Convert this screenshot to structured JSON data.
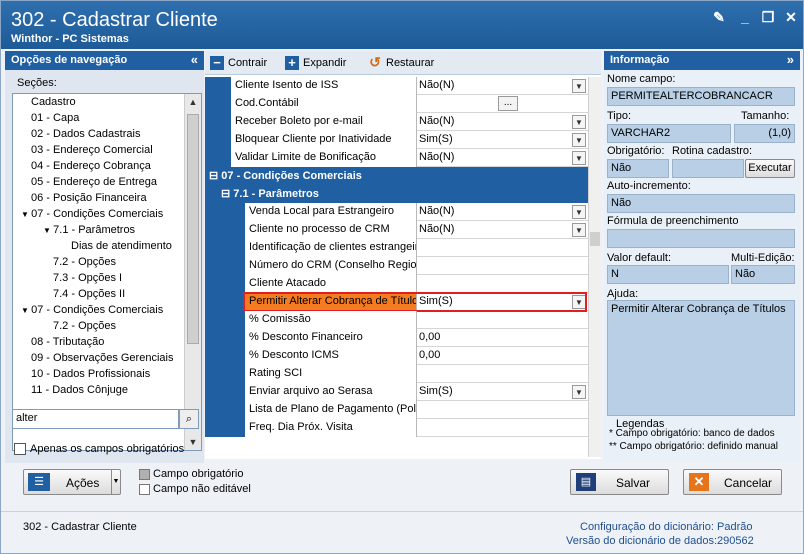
{
  "window": {
    "title": "302 - Cadastrar Cliente",
    "subtitle": "Winthor - PC Sistemas"
  },
  "nav": {
    "header": "Opções de navegação",
    "sections_label": "Seções:",
    "items": [
      "Cadastro",
      "01 - Capa",
      "02 - Dados Cadastrais",
      "03 - Endereço Comercial",
      "04 - Endereço Cobrança",
      "05 - Endereço de Entrega",
      "06 - Posição Financeira",
      "07 - Condições Comerciais",
      "7.1 - Parâmetros",
      "Dias de atendimento",
      "7.2 - Opções",
      "7.3 - Opções I",
      "7.4 - Opções II",
      "07 - Condições Comerciais",
      "7.2 - Opções",
      "08 - Tributação",
      "09 - Observações Gerenciais",
      "10 - Dados Profissionais",
      "11 - Dados Cônjuge"
    ],
    "search_value": "alter",
    "only_required_label": "Apenas os campos obrigatórios"
  },
  "toolbar": {
    "collapse": "Contrair",
    "expand": "Expandir",
    "restore": "Restaurar"
  },
  "grid": {
    "rows_top": [
      {
        "label": "Cliente Isento de ISS",
        "value": "Não(N)"
      },
      {
        "label": "Cod.Contábil",
        "value": ""
      },
      {
        "label": "Receber Boleto por e-mail",
        "value": "Não(N)"
      },
      {
        "label": "Bloquear Cliente por Inatividade",
        "value": "Sim(S)"
      },
      {
        "label": "Validar Limite de Bonificação",
        "value": "Não(N)"
      }
    ],
    "category": "07 - Condições Comerciais",
    "subcategory": "7.1 - Parâmetros",
    "rows_sub": [
      {
        "label": "Venda Local para Estrangeiro",
        "value": "Não(N)"
      },
      {
        "label": "Cliente no processo de CRM",
        "value": "Não(N)"
      },
      {
        "label": "Identificação de clientes estrangeiros",
        "value": ""
      },
      {
        "label": "Número do CRM (Conselho Regional",
        "value": ""
      },
      {
        "label": "Cliente Atacado",
        "value": ""
      },
      {
        "label": "Permitir Alterar Cobrança de Títulos",
        "value": "Sim(S)"
      },
      {
        "label": "% Comissão",
        "value": ""
      },
      {
        "label": "% Desconto Financeiro",
        "value": "0,00"
      },
      {
        "label": "% Desconto ICMS",
        "value": "0,00"
      },
      {
        "label": "Rating SCI",
        "value": ""
      },
      {
        "label": "Enviar arquivo ao Serasa",
        "value": "Sim(S)"
      },
      {
        "label": "Lista de Plano de Pagamento (Polit",
        "value": ""
      },
      {
        "label": "Freq. Dia Próx. Visita",
        "value": ""
      }
    ]
  },
  "info": {
    "header": "Informação",
    "field_name_label": "Nome campo:",
    "field_name": "PERMITEALTERCOBRANCACR",
    "type_label": "Tipo:",
    "type": "VARCHAR2",
    "size_label": "Tamanho:",
    "size": "(1,0)",
    "required_label": "Obrigatório:",
    "required": "Não",
    "routine_label": "Rotina cadastro:",
    "execute_btn": "Executar",
    "autoinc_label": "Auto-incremento:",
    "autoinc": "Não",
    "formula_label": "Fórmula de preenchimento",
    "default_label": "Valor default:",
    "default": "N",
    "multi_label": "Multi-Edição:",
    "multi": "Não",
    "help_label": "Ajuda:",
    "help": "Permitir Alterar Cobrança de Títulos",
    "legend_title": "Legendas",
    "legend1": "* Campo obrigatório: banco de dados",
    "legend2": "** Campo obrigatório: definido manual"
  },
  "actions": {
    "acoes": "Ações",
    "required_legend": "Campo obrigatório",
    "noneditable_legend": "Campo não editável",
    "save": "Salvar",
    "cancel": "Cancelar"
  },
  "footer": {
    "routine": "302 - Cadastrar Cliente",
    "dict_config_label": "Configuração do dicionário:",
    "dict_config": "Padrão",
    "dict_version_label": "Versão do dicionário de dados:",
    "dict_version": "290562"
  }
}
